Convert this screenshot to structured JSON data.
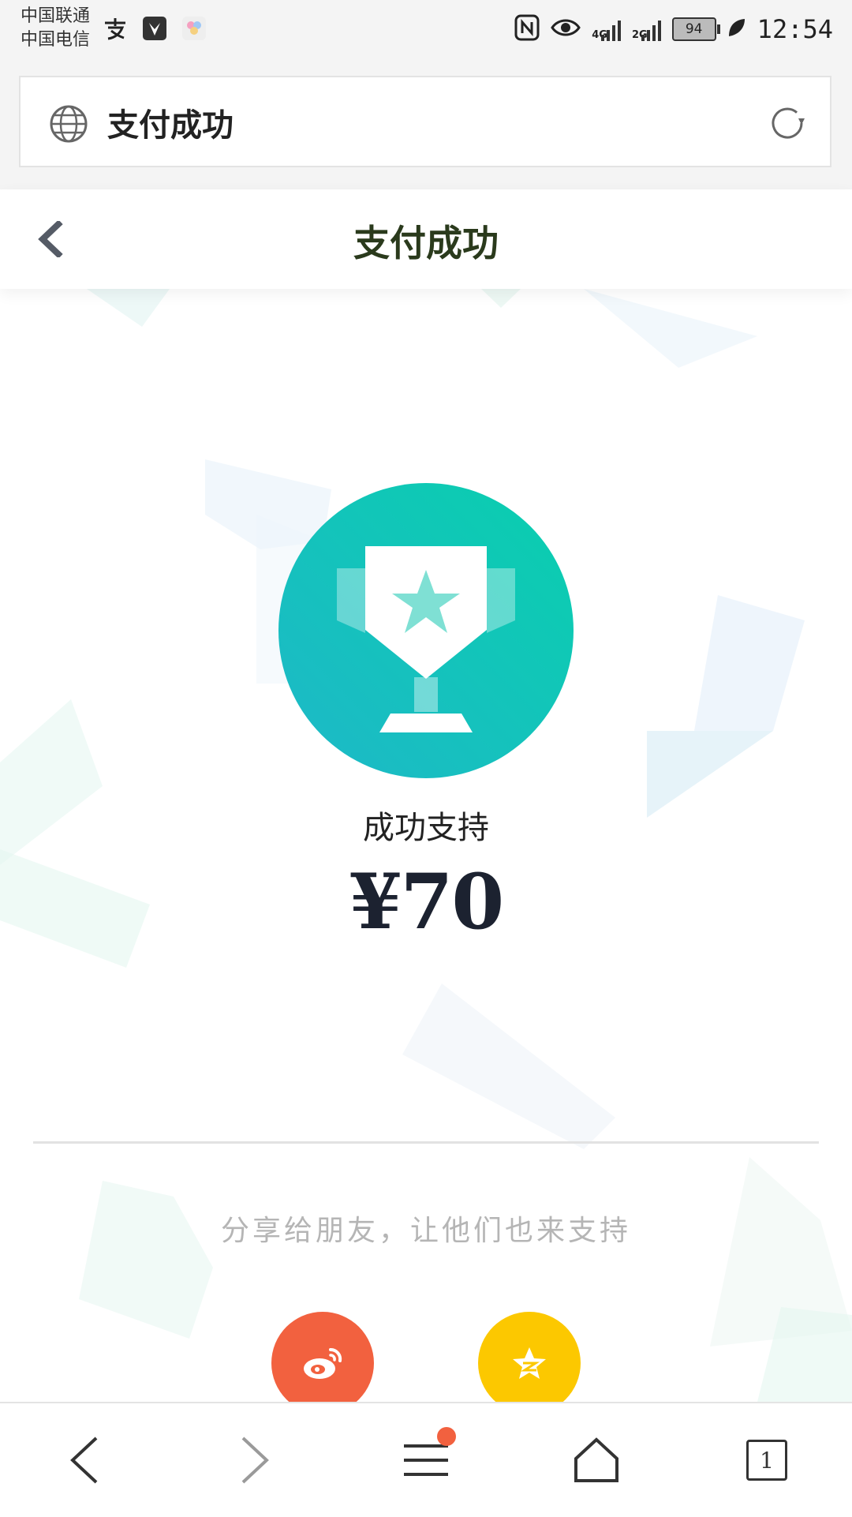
{
  "status_bar": {
    "carrier_1": "中国联通",
    "carrier_2": "中国电信",
    "left_icons": [
      "alipay-icon",
      "huawei-icon",
      "gallery-icon"
    ],
    "network_4g": "4G",
    "network_2g": "2G",
    "battery": "94",
    "time": "12:54"
  },
  "url_bar": {
    "title": "支付成功"
  },
  "header": {
    "title": "支付成功"
  },
  "result": {
    "label": "成功支持",
    "amount": "¥70"
  },
  "share": {
    "prompt": "分享给朋友，让他们也来支持",
    "buttons": [
      {
        "name": "weibo",
        "color": "#f2613f"
      },
      {
        "name": "qzone",
        "color": "#fcc800"
      }
    ]
  },
  "bottom_nav": {
    "tab_count": "1",
    "items": [
      "back-icon",
      "forward-icon",
      "menu-icon",
      "home-icon",
      "tabs-icon"
    ]
  },
  "colors": {
    "trophy_gradient_start": "#09cfae",
    "trophy_gradient_end": "#1eb8c8",
    "accent_red": "#f2613f",
    "accent_yellow": "#fcc800"
  }
}
